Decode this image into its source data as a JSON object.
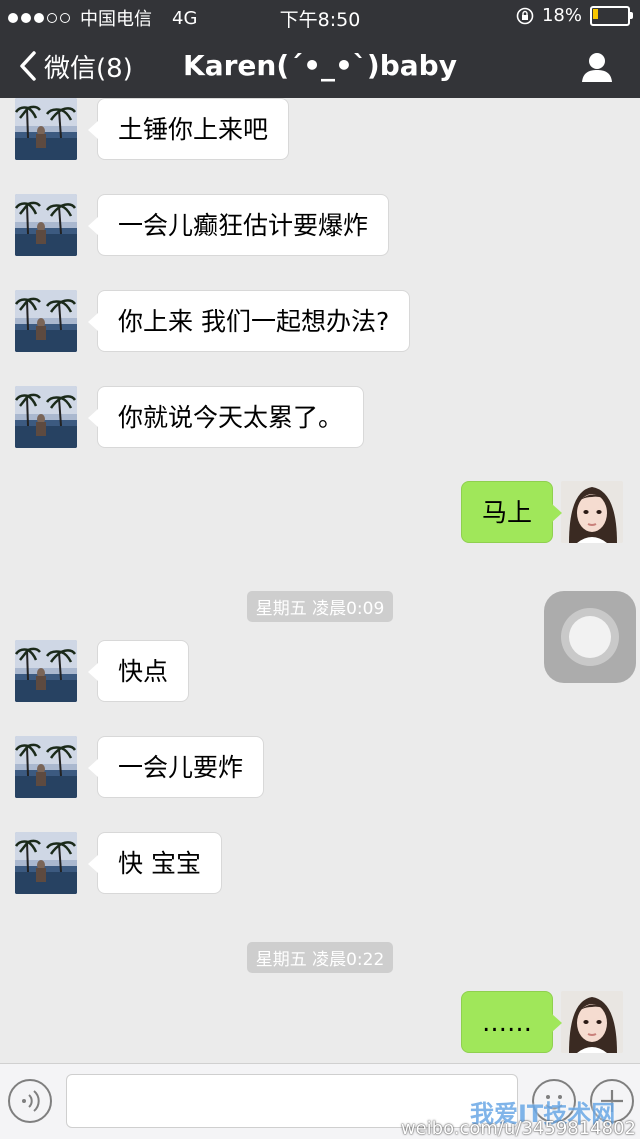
{
  "status_bar": {
    "carrier": "中国电信",
    "network": "4G",
    "time": "下午8:50",
    "battery_percent": "18%",
    "battery_level": 0.18
  },
  "nav": {
    "back_label": "微信(8)",
    "title": "Karen(´•_•`)baby"
  },
  "messages": [
    {
      "side": "left",
      "text": "土锤你上来吧"
    },
    {
      "side": "left",
      "text": "一会儿癫狂估计要爆炸"
    },
    {
      "side": "left",
      "text": "你上来 我们一起想办法?"
    },
    {
      "side": "left",
      "text": "你就说今天太累了。"
    },
    {
      "side": "right",
      "text": "马上"
    },
    {
      "type": "time",
      "text": "星期五 凌晨0:09"
    },
    {
      "side": "left",
      "text": "快点"
    },
    {
      "side": "left",
      "text": "一会儿要炸"
    },
    {
      "side": "left",
      "text": "快 宝宝"
    },
    {
      "type": "time",
      "text": "星期五 凌晨0:22"
    },
    {
      "side": "right",
      "text": "……"
    }
  ],
  "watermark": {
    "site": "我爱IT技术网",
    "weibo": "weibo.com/u/3459814802"
  },
  "colors": {
    "header_bg": "#333438",
    "chat_bg": "#ebebeb",
    "bubble_in": "#ffffff",
    "bubble_out": "#a0e75a",
    "battery": "#f7c600"
  }
}
